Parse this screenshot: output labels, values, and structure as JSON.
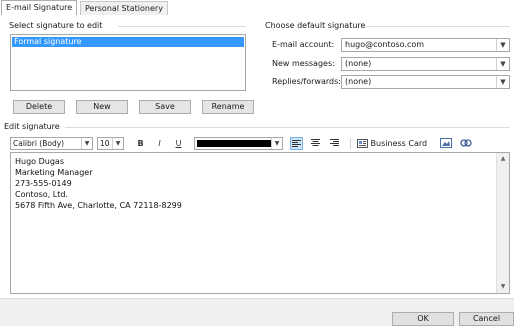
{
  "tabs": [
    {
      "label": "E-mail Signature",
      "active": true
    },
    {
      "label": "Personal Stationery",
      "active": false
    }
  ],
  "select_section": {
    "label": "Select signature to edit",
    "items": [
      "Formal signature"
    ],
    "selected": "Formal signature"
  },
  "signature_buttons": {
    "delete": "Delete",
    "new": "New",
    "save": "Save",
    "rename": "Rename"
  },
  "default_section": {
    "label": "Choose default signature",
    "email_account_label": "E-mail account:",
    "email_account_value": "hugo@contoso.com",
    "new_messages_label": "New messages:",
    "new_messages_value": "(none)",
    "replies_label": "Replies/forwards:",
    "replies_value": "(none)"
  },
  "edit_section": {
    "label": "Edit signature",
    "font": "Calibri (Body)",
    "size": "10",
    "bold_label": "B",
    "italic_label": "I",
    "underline_label": "U",
    "font_color": "#000000",
    "business_card_label": "Business Card",
    "signature_lines": [
      "Hugo Dugas",
      "Marketing Manager",
      "273-555-0149",
      "Contoso, Ltd.",
      "5678 Fifth Ave, Charlotte, CA 72118-8299"
    ]
  },
  "footer": {
    "ok": "OK",
    "cancel": "Cancel"
  },
  "colors": {
    "selection": "#3399ff",
    "pressed": "#cce4f7"
  }
}
